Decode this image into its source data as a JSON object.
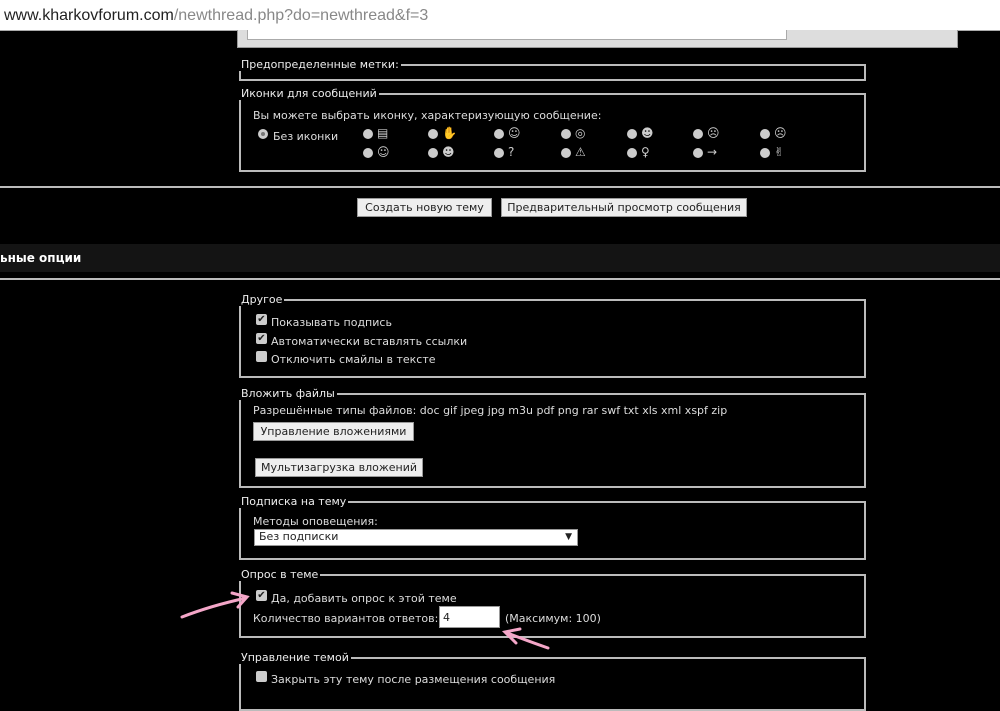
{
  "browser": {
    "url_domain": "www.kharkovforum.com",
    "url_path": "/newthread.php?do=newthread&f=3"
  },
  "prefixes": {
    "legend": "Предопределенные метки:"
  },
  "post_icons": {
    "legend": "Иконки для сообщений",
    "hint": "Вы можете выбрать иконку, характеризующую сообщение:",
    "no_icon_label": "Без иконки",
    "icons": [
      "document-icon",
      "thumbs-down-icon",
      "smile-icon",
      "surprised-icon",
      "grin-icon",
      "sad-icon",
      "angry-icon",
      "happy-icon",
      "cool-icon",
      "question-icon",
      "warning-icon",
      "lightbulb-icon",
      "arrow-right-icon",
      "thumbs-up-icon"
    ]
  },
  "actions": {
    "submit": "Создать новую тему",
    "preview": "Предварительный просмотр сообщения"
  },
  "section_title": "ьные опции",
  "misc": {
    "legend": "Другое",
    "options": [
      {
        "label": "Показывать подпись",
        "checked": true
      },
      {
        "label": "Автоматически вставлять ссылки",
        "checked": true
      },
      {
        "label": "Отключить смайлы в тексте",
        "checked": false
      }
    ]
  },
  "attachments": {
    "legend": "Вложить файлы",
    "allowed": "Разрешённые типы файлов: doc gif jpeg jpg m3u pdf png rar swf txt xls xml xspf zip",
    "manage": "Управление вложениями",
    "multi": "Мультизагрузка вложений"
  },
  "subscription": {
    "legend": "Подписка на тему",
    "label": "Методы оповещения:",
    "selected": "Без подписки"
  },
  "poll": {
    "legend": "Опрос в теме",
    "add_label": "Да, добавить опрос к этой теме",
    "add_checked": true,
    "count_label": "Количество вариантов ответов:",
    "count_value": "4",
    "max_note": "(Максимум: 100)"
  },
  "thread_mgmt": {
    "legend": "Управление темой",
    "close_label": "Закрыть эту тему после размещения сообщения",
    "close_checked": false
  },
  "annotation_color": "#f4a6c8"
}
